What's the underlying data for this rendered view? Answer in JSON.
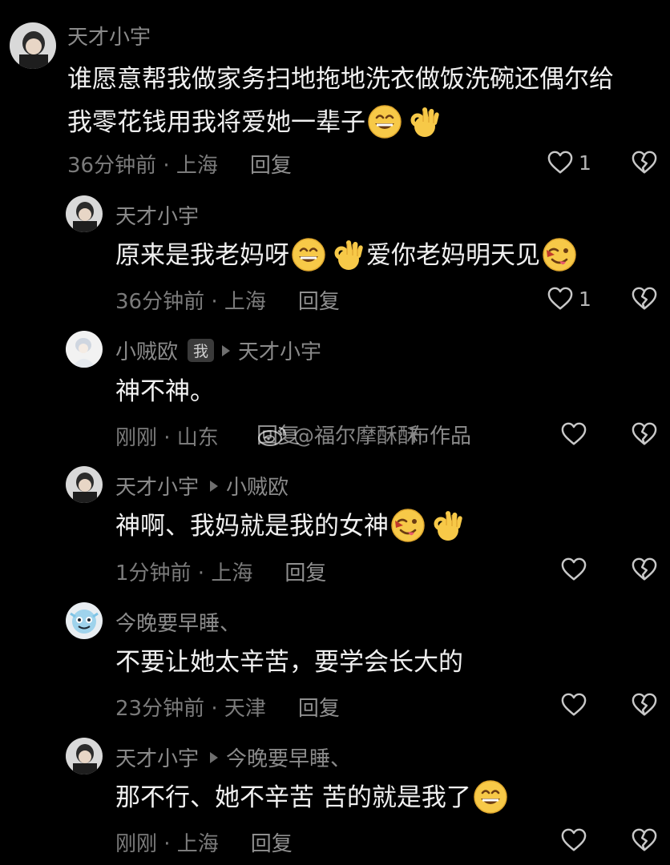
{
  "comments": [
    {
      "username": "天才小宇",
      "text_line1": "谁愿意帮我做家务扫地拖地洗衣做饭洗碗还偶尔给",
      "text_line2": "我零花钱用我将爱她一辈子",
      "time_location": "36分钟前 · 上海",
      "reply_label": "回复",
      "like_count": "1"
    },
    {
      "username": "天才小宇",
      "text_part1": "原来是我老妈呀",
      "text_part2": "爱你老妈明天见",
      "time_location": "36分钟前 · 上海",
      "reply_label": "回复",
      "like_count": "1"
    },
    {
      "username": "小贼欧",
      "badge": "我",
      "reply_to": "天才小宇",
      "text": "神不神。",
      "time_location": "刚刚 · 山东",
      "reply_label": "回复"
    },
    {
      "username": "天才小宇",
      "reply_to": "小贼欧",
      "text": "神啊、我妈就是我的女神",
      "time_location": "1分钟前 · 上海",
      "reply_label": "回复"
    },
    {
      "username": "今晚要早睡、",
      "text": "不要让她太辛苦，要学会长大的",
      "time_location": "23分钟前 · 天津",
      "reply_label": "回复"
    },
    {
      "username": "天才小宇",
      "reply_to": "今晚要早睡、",
      "text": "那不行、她不辛苦 苦的就是我了",
      "time_location": "刚刚 · 上海",
      "reply_label": "回复"
    }
  ],
  "watermark": {
    "text": "@福尔摩酥酥",
    "overlay_text": "布作品"
  },
  "colors": {
    "background": "#000000",
    "text": "#f0f0f0",
    "muted": "#7b7b7b",
    "emoji_yellow": "#f7c948"
  },
  "icons": {
    "like": "heart-outline-icon",
    "dislike": "broken-heart-icon",
    "grin": "grinning-face-emoji",
    "ok": "ok-hand-emoji",
    "wink": "winking-tongue-face-emoji",
    "weibo": "weibo-logo-icon"
  }
}
